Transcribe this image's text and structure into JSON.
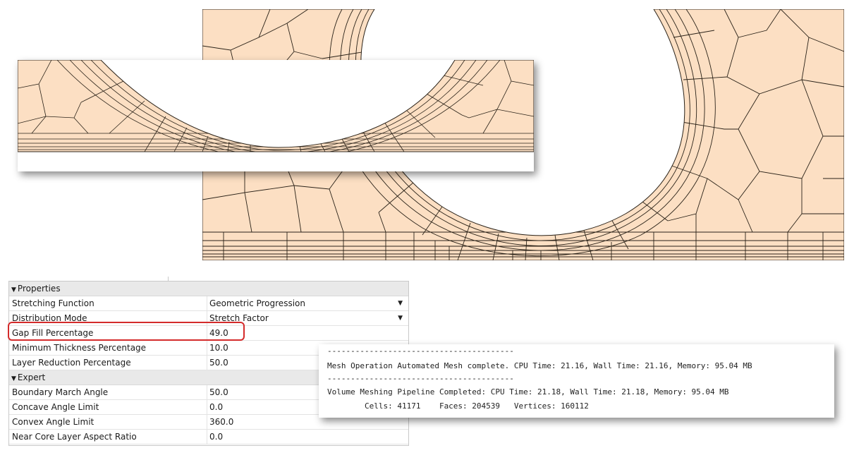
{
  "properties": {
    "sections": {
      "properties": "Properties",
      "expert": "Expert"
    },
    "rows": [
      {
        "label": "Stretching Function",
        "value": "Geometric Progression",
        "dropdown": true
      },
      {
        "label": "Distribution Mode",
        "value": "Stretch Factor",
        "dropdown": true
      },
      {
        "label": "Gap Fill Percentage",
        "value": "49.0",
        "highlighted": true
      },
      {
        "label": "Minimum Thickness Percentage",
        "value": "10.0"
      },
      {
        "label": "Layer Reduction Percentage",
        "value": "50.0"
      }
    ],
    "expert_rows": [
      {
        "label": "Boundary March Angle",
        "value": "50.0"
      },
      {
        "label": "Concave Angle Limit",
        "value": "0.0"
      },
      {
        "label": "Convex Angle Limit",
        "value": "360.0"
      },
      {
        "label": "Near Core Layer Aspect Ratio",
        "value": "0.0"
      }
    ]
  },
  "console": {
    "separator": "----------------------------------------",
    "line1": "Mesh Operation Automated Mesh complete. CPU Time: 21.16, Wall Time: 21.16, Memory: 95.04 MB",
    "line2": "Volume Meshing Pipeline Completed: CPU Time: 21.18, Wall Time: 21.18, Memory: 95.04 MB",
    "line3": "        Cells: 41171    Faces: 204539   Vertices: 160112"
  },
  "colors": {
    "mesh_fill": "#fcdfc3",
    "mesh_line": "#2a2218",
    "highlight": "#d42b2b"
  }
}
